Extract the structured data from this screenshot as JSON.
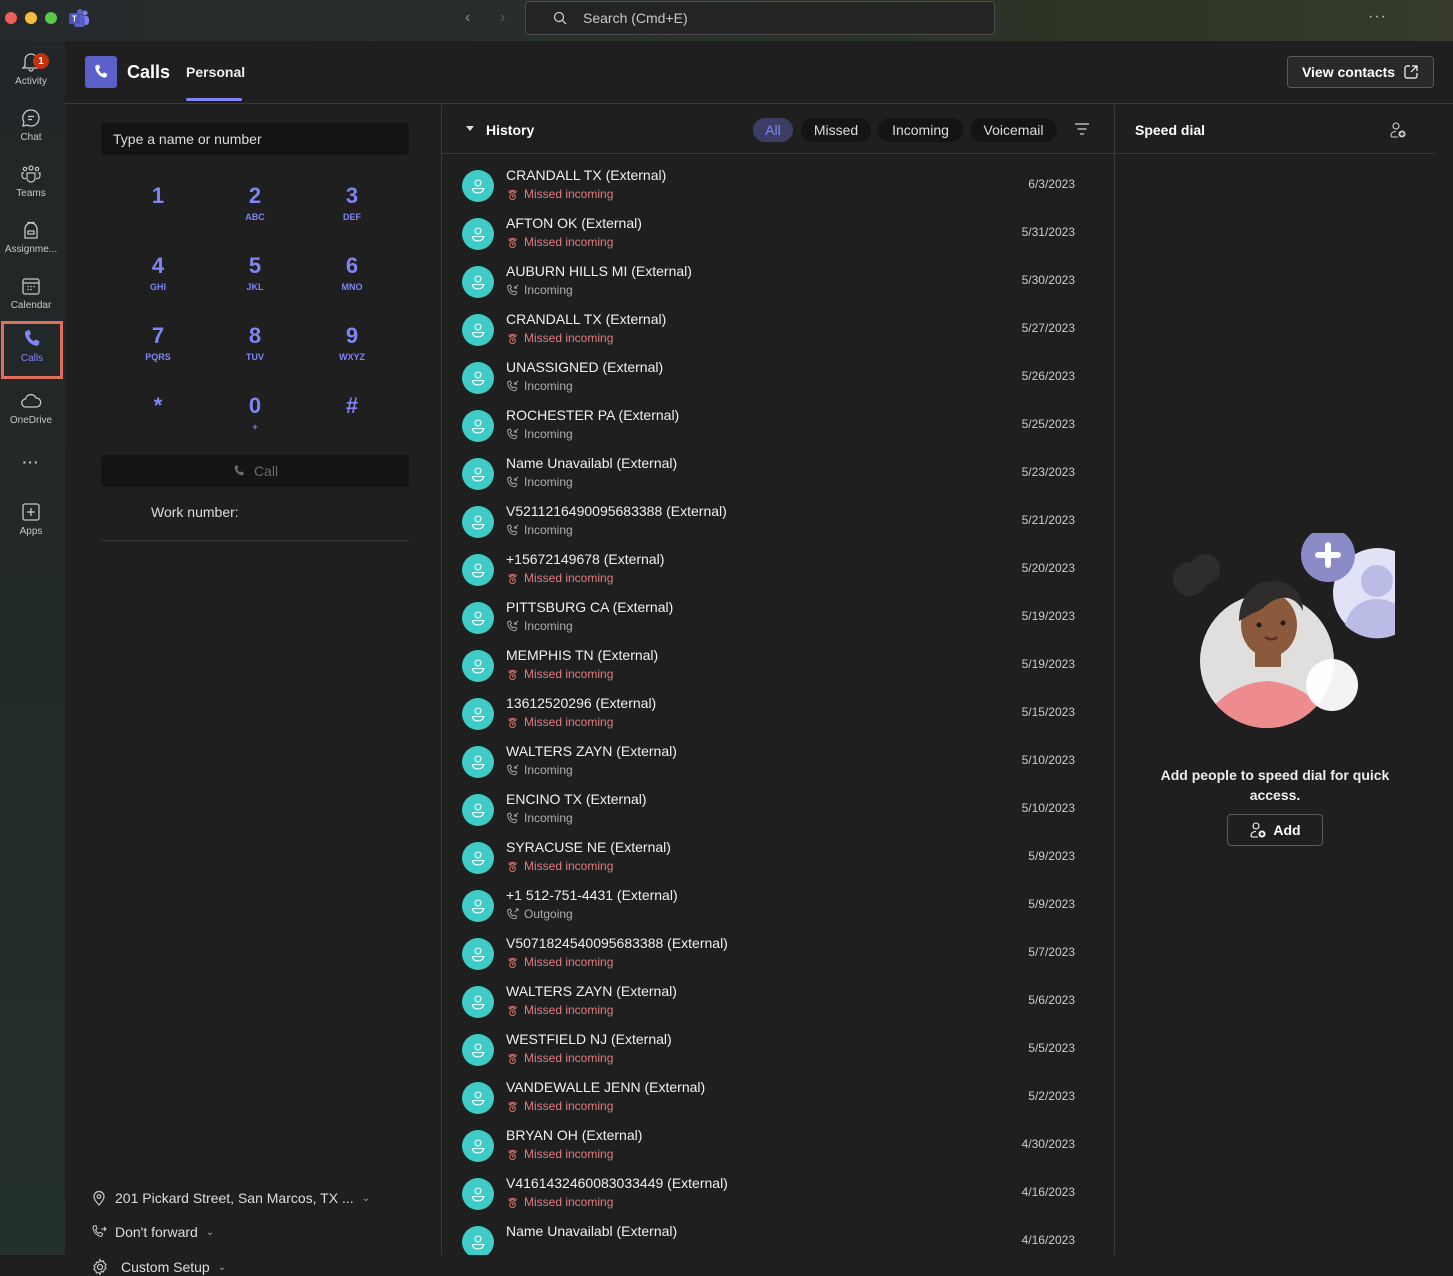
{
  "titlebar": {
    "search_placeholder": "Search (Cmd+E)",
    "more_label": "···"
  },
  "rail": {
    "items": [
      {
        "label": "Activity",
        "icon": "bell-icon",
        "badge": "1"
      },
      {
        "label": "Chat",
        "icon": "chat-icon"
      },
      {
        "label": "Teams",
        "icon": "teams-icon"
      },
      {
        "label": "Assignme...",
        "icon": "backpack-icon"
      },
      {
        "label": "Calendar",
        "icon": "calendar-icon"
      },
      {
        "label": "Calls",
        "icon": "phone-icon",
        "active": true
      },
      {
        "label": "OneDrive",
        "icon": "cloud-icon"
      },
      {
        "label": "···",
        "icon": "more-icon"
      },
      {
        "label": "Apps",
        "icon": "apps-plus-icon"
      }
    ]
  },
  "header": {
    "title": "Calls",
    "tab": "Personal",
    "view_contacts": "View contacts"
  },
  "dialpad": {
    "input_placeholder": "Type a name or number",
    "keys": [
      {
        "num": "1",
        "sub": ""
      },
      {
        "num": "2",
        "sub": "ABC"
      },
      {
        "num": "3",
        "sub": "DEF"
      },
      {
        "num": "4",
        "sub": "GHI"
      },
      {
        "num": "5",
        "sub": "JKL"
      },
      {
        "num": "6",
        "sub": "MNO"
      },
      {
        "num": "7",
        "sub": "PQRS"
      },
      {
        "num": "8",
        "sub": "TUV"
      },
      {
        "num": "9",
        "sub": "WXYZ"
      },
      {
        "num": "*",
        "sub": ""
      },
      {
        "num": "0",
        "sub": "+"
      },
      {
        "num": "#",
        "sub": ""
      }
    ],
    "call_label": "Call",
    "work_number_label": "Work number:",
    "location": "201 Pickard Street, San Marcos, TX ...",
    "forward": "Don't forward",
    "setup": "Custom Setup"
  },
  "history": {
    "title": "History",
    "filters": [
      "All",
      "Missed",
      "Incoming",
      "Voicemail"
    ],
    "active_filter": "All",
    "calls": [
      {
        "name": "CRANDALL TX (External)",
        "status": "Missed incoming",
        "type": "missed",
        "date": "6/3/2023"
      },
      {
        "name": "AFTON OK (External)",
        "status": "Missed incoming",
        "type": "missed",
        "date": "5/31/2023"
      },
      {
        "name": "AUBURN HILLS MI (External)",
        "status": "Incoming",
        "type": "incoming",
        "date": "5/30/2023"
      },
      {
        "name": "CRANDALL TX (External)",
        "status": "Missed incoming",
        "type": "missed",
        "date": "5/27/2023"
      },
      {
        "name": "UNASSIGNED (External)",
        "status": "Incoming",
        "type": "incoming",
        "date": "5/26/2023"
      },
      {
        "name": "ROCHESTER PA (External)",
        "status": "Incoming",
        "type": "incoming",
        "date": "5/25/2023"
      },
      {
        "name": "Name Unavailabl (External)",
        "status": "Incoming",
        "type": "incoming",
        "date": "5/23/2023"
      },
      {
        "name": "V5211216490095683388 (External)",
        "status": "Incoming",
        "type": "incoming",
        "date": "5/21/2023"
      },
      {
        "name": "+15672149678 (External)",
        "status": "Missed incoming",
        "type": "missed",
        "date": "5/20/2023"
      },
      {
        "name": "PITTSBURG CA (External)",
        "status": "Incoming",
        "type": "incoming",
        "date": "5/19/2023"
      },
      {
        "name": "MEMPHIS TN (External)",
        "status": "Missed incoming",
        "type": "missed",
        "date": "5/19/2023"
      },
      {
        "name": "13612520296 (External)",
        "status": "Missed incoming",
        "type": "missed",
        "date": "5/15/2023"
      },
      {
        "name": "WALTERS ZAYN (External)",
        "status": "Incoming",
        "type": "incoming",
        "date": "5/10/2023"
      },
      {
        "name": "ENCINO TX (External)",
        "status": "Incoming",
        "type": "incoming",
        "date": "5/10/2023"
      },
      {
        "name": "SYRACUSE NE (External)",
        "status": "Missed incoming",
        "type": "missed",
        "date": "5/9/2023"
      },
      {
        "name": "+1 512-751-4431 (External)",
        "status": "Outgoing",
        "type": "outgoing",
        "date": "5/9/2023"
      },
      {
        "name": "V5071824540095683388 (External)",
        "status": "Missed incoming",
        "type": "missed",
        "date": "5/7/2023"
      },
      {
        "name": "WALTERS ZAYN (External)",
        "status": "Missed incoming",
        "type": "missed",
        "date": "5/6/2023"
      },
      {
        "name": "WESTFIELD NJ (External)",
        "status": "Missed incoming",
        "type": "missed",
        "date": "5/5/2023"
      },
      {
        "name": "VANDEWALLE JENN (External)",
        "status": "Missed incoming",
        "type": "missed",
        "date": "5/2/2023"
      },
      {
        "name": "BRYAN OH (External)",
        "status": "Missed incoming",
        "type": "missed",
        "date": "4/30/2023"
      },
      {
        "name": "V4161432460083033449 (External)",
        "status": "Missed incoming",
        "type": "missed",
        "date": "4/16/2023"
      },
      {
        "name": "Name Unavailabl (External)",
        "status": "",
        "type": "incoming",
        "date": "4/16/2023"
      }
    ]
  },
  "speed_dial": {
    "title": "Speed dial",
    "empty_message": "Add people to speed dial for quick access.",
    "add_label": "Add"
  },
  "colors": {
    "accent": "#7f85f5",
    "brand": "#5b5fc7",
    "missed": "#e37d80",
    "avatar": "#3fcbc7",
    "active_tab_outline": "#e06c5b"
  }
}
